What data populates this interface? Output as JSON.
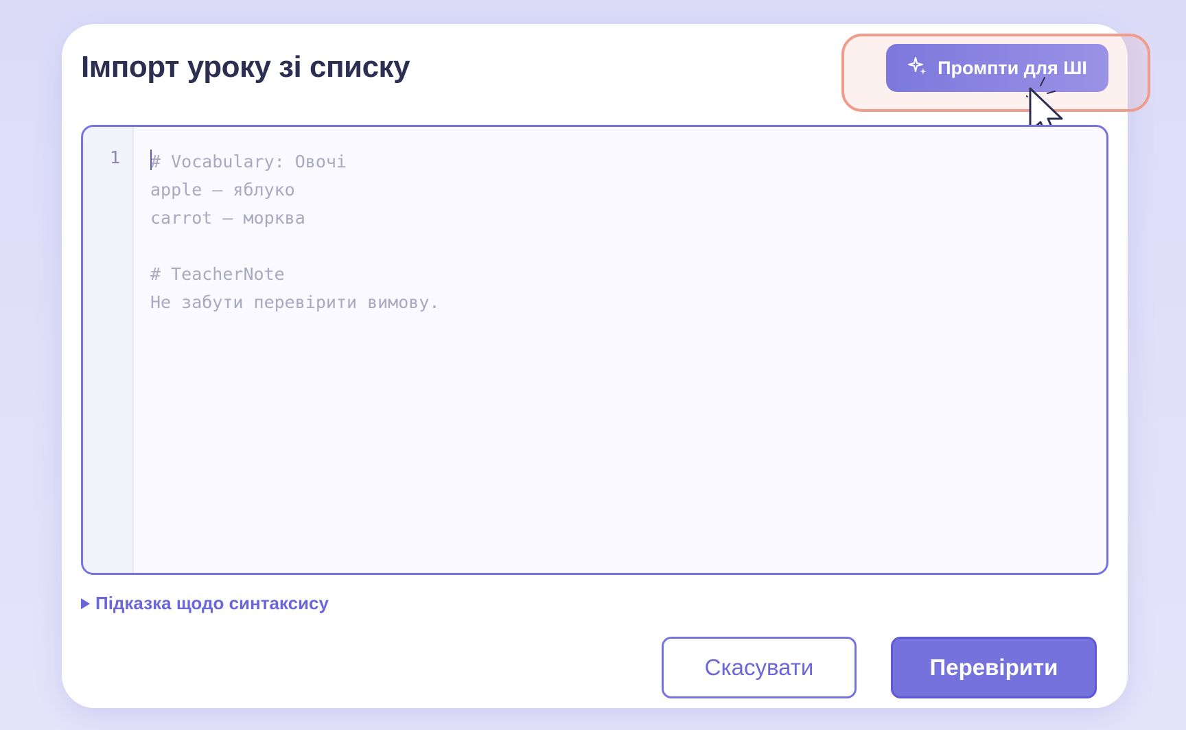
{
  "dialog": {
    "title": "Імпорт уроку зі списку"
  },
  "ai_button": {
    "label": "Промпти для ШІ",
    "icon": "sparkle-icon"
  },
  "editor": {
    "line_numbers": [
      "1"
    ],
    "lines": [
      "# Vocabulary: Овочі",
      "apple — яблуко",
      "carrot — морква",
      "",
      "# TeacherNote",
      "Не забути перевірити вимову."
    ]
  },
  "hint": {
    "label": "Підказка щодо синтаксису",
    "icon": "triangle-right-icon"
  },
  "actions": {
    "cancel_label": "Скасувати",
    "check_label": "Перевірити"
  },
  "colors": {
    "accent": "#7673de",
    "highlight": "#ef9c8d",
    "title": "#2d2f52"
  }
}
